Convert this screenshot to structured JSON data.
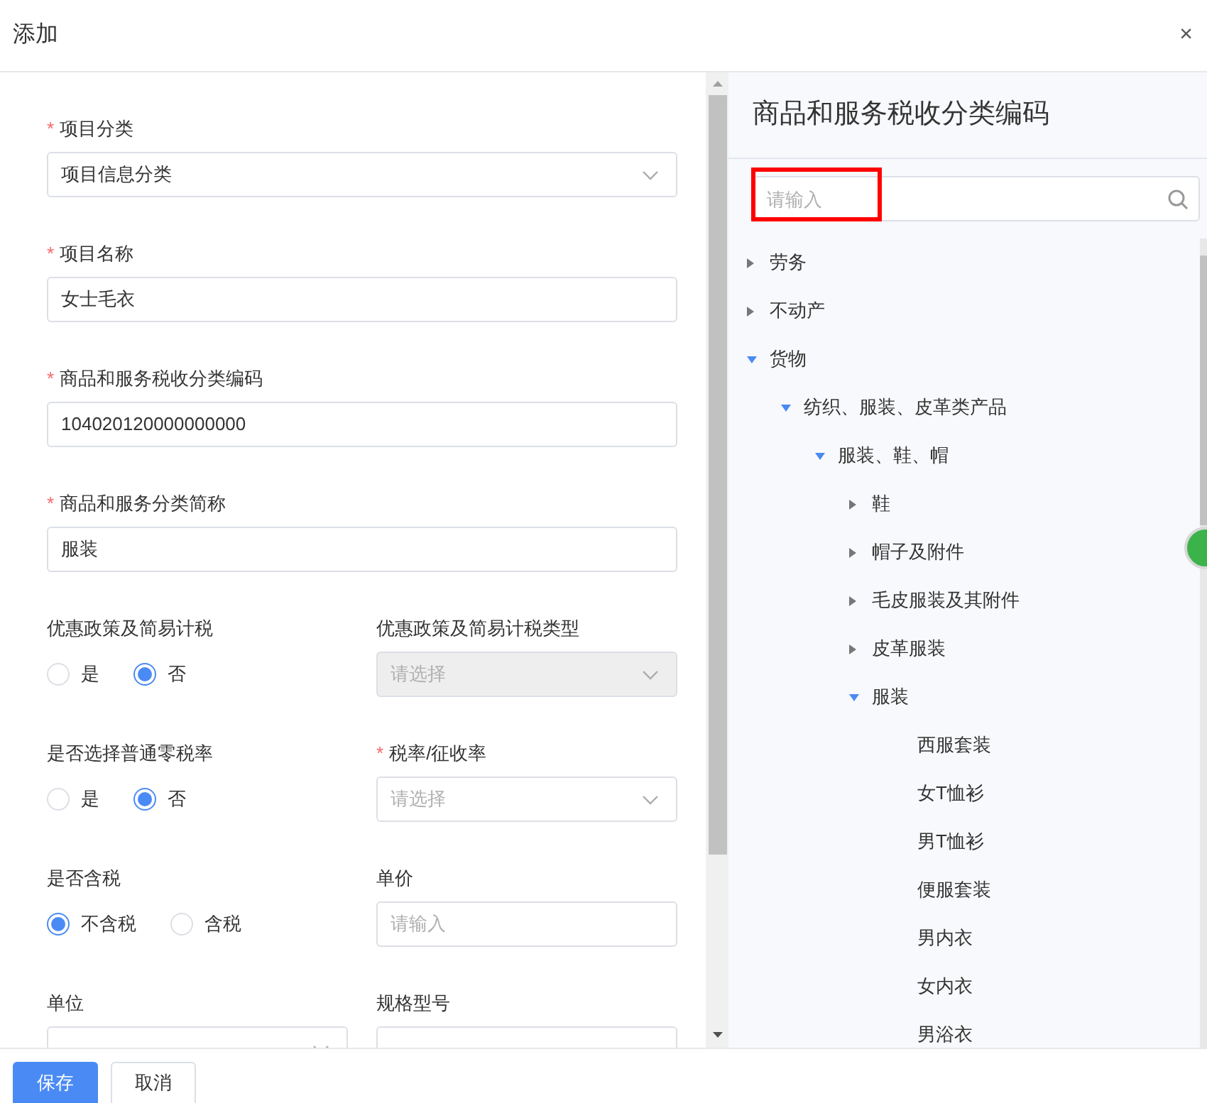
{
  "dialog": {
    "title": "添加",
    "close": "×"
  },
  "form": {
    "rows": [
      [
        {
          "kind": "select",
          "label": "项目分类",
          "required_mark": "*",
          "value": "项目信息分类",
          "disabled": false
        }
      ],
      [
        {
          "kind": "input",
          "label": "项目名称",
          "required_mark": "*",
          "value": "女士毛衣"
        }
      ],
      [
        {
          "kind": "input",
          "label": "商品和服务税收分类编码",
          "required_mark": "*",
          "value": "104020120000000000"
        }
      ],
      [
        {
          "kind": "input",
          "label": "商品和服务分类简称",
          "required_mark": "*",
          "value": "服装"
        }
      ],
      [
        {
          "kind": "radio",
          "label": "优惠政策及简易计税",
          "options": [
            {
              "label": "是",
              "selected": false
            },
            {
              "label": "否",
              "selected": true
            }
          ]
        },
        {
          "kind": "select",
          "label": "优惠政策及简易计税类型",
          "placeholder": "请选择",
          "disabled": true
        }
      ],
      [
        {
          "kind": "radio",
          "label": "是否选择普通零税率",
          "options": [
            {
              "label": "是",
              "selected": false
            },
            {
              "label": "否",
              "selected": true
            }
          ]
        },
        {
          "kind": "select",
          "label": "税率/征收率",
          "required_mark": "*",
          "placeholder": "请选择",
          "disabled": false
        }
      ],
      [
        {
          "kind": "radio",
          "label": "是否含税",
          "options": [
            {
              "label": "不含税",
              "selected": true
            },
            {
              "label": "含税",
              "selected": false
            }
          ]
        },
        {
          "kind": "input",
          "label": "单价",
          "placeholder": "请输入"
        }
      ],
      [
        {
          "kind": "select",
          "label": "单位",
          "disabled": false
        },
        {
          "kind": "input",
          "label": "规格型号"
        }
      ]
    ]
  },
  "panel": {
    "title": "商品和服务税收分类编码",
    "search": {
      "placeholder": "请输入"
    },
    "tree": [
      {
        "label": "劳务",
        "kind": "branch",
        "expanded": false
      },
      {
        "label": "不动产",
        "kind": "branch",
        "expanded": false
      },
      {
        "label": "货物",
        "kind": "branch",
        "expanded": true,
        "children": [
          {
            "label": "纺织、服装、皮革类产品",
            "kind": "branch",
            "expanded": true,
            "children": [
              {
                "label": "服装、鞋、帽",
                "kind": "branch",
                "expanded": true,
                "children": [
                  {
                    "label": "鞋",
                    "kind": "branch",
                    "expanded": false
                  },
                  {
                    "label": "帽子及附件",
                    "kind": "branch",
                    "expanded": false
                  },
                  {
                    "label": "毛皮服装及其附件",
                    "kind": "branch",
                    "expanded": false
                  },
                  {
                    "label": "皮革服装",
                    "kind": "branch",
                    "expanded": false
                  },
                  {
                    "label": "服装",
                    "kind": "branch",
                    "expanded": true,
                    "children": [
                      {
                        "label": "西服套装",
                        "kind": "leaf"
                      },
                      {
                        "label": "女T恤衫",
                        "kind": "leaf"
                      },
                      {
                        "label": "男T恤衫",
                        "kind": "leaf"
                      },
                      {
                        "label": "便服套装",
                        "kind": "leaf"
                      },
                      {
                        "label": "男内衣",
                        "kind": "leaf"
                      },
                      {
                        "label": "女内衣",
                        "kind": "leaf"
                      },
                      {
                        "label": "男浴衣",
                        "kind": "leaf"
                      }
                    ]
                  }
                ]
              }
            ]
          }
        ]
      }
    ]
  },
  "buttons": [
    {
      "label": "保存",
      "kind": "primary"
    },
    {
      "label": "取消",
      "kind": "default"
    }
  ]
}
